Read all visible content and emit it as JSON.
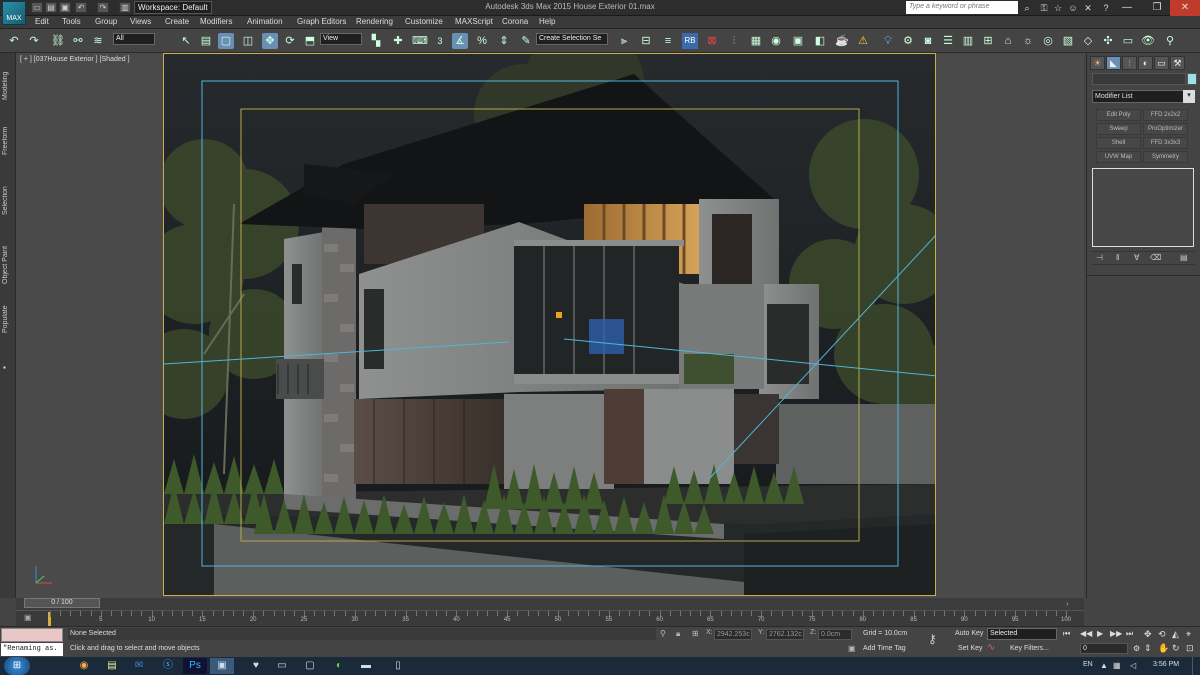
{
  "app": {
    "icon_label": "MAX",
    "title": "Autodesk 3ds Max 2015    House Exterior 01.max",
    "workspace": "Workspace: Default",
    "search_placeholder": "Type a keyword or phrase"
  },
  "menu": [
    "Edit",
    "Tools",
    "Group",
    "Views",
    "Create",
    "Modifiers",
    "Animation",
    "Graph Editors",
    "Rendering",
    "Customize",
    "MAXScript",
    "Corona",
    "Help"
  ],
  "toolbar": {
    "filter_value": "All",
    "ref_coord_value": "View",
    "selection_set_value": "Create Selection Se",
    "snap_label": "3"
  },
  "left_tabs": [
    "Modeling",
    "Freeform",
    "Selection",
    "Object Paint",
    "Populate"
  ],
  "viewport": {
    "label": "[ + ] [037House Exterior ] [Shaded ]"
  },
  "command_panel": {
    "modifier_list": "Modifier List",
    "modifier_buttons": [
      "Edit Poly",
      "FFD 2x2x2",
      "Sweep",
      "ProOptimizer",
      "Shell",
      "FFD 3x3x3",
      "UVW Map",
      "Symmetry"
    ]
  },
  "timeline": {
    "frame": "0 / 100",
    "ticks": [
      "5",
      "10",
      "15",
      "20",
      "25",
      "30",
      "35",
      "40",
      "45",
      "50",
      "55",
      "60",
      "65",
      "70",
      "75",
      "80",
      "85",
      "90",
      "95",
      "100"
    ]
  },
  "status": {
    "maxscript_output": "\"Renaming as.",
    "selection": "None Selected",
    "prompt": "Click and drag to select and move objects",
    "x": "2942.253c",
    "y": "2762.132c",
    "z": "0.0cm",
    "grid": "Grid = 10.0cm",
    "add_time_tag": "Add Time Tag",
    "auto_key": "Auto Key",
    "selected_value": "Selected",
    "set_key": "Set Key",
    "key_filters": "Key Filters...",
    "current_frame": "0"
  },
  "taskbar": {
    "lang": "EN",
    "time": "3:56 PM"
  },
  "colors": {
    "viewport_frame": "#c8b04b",
    "camera_line": "#4fb6d8",
    "safe_frame": "#b5a84a"
  }
}
